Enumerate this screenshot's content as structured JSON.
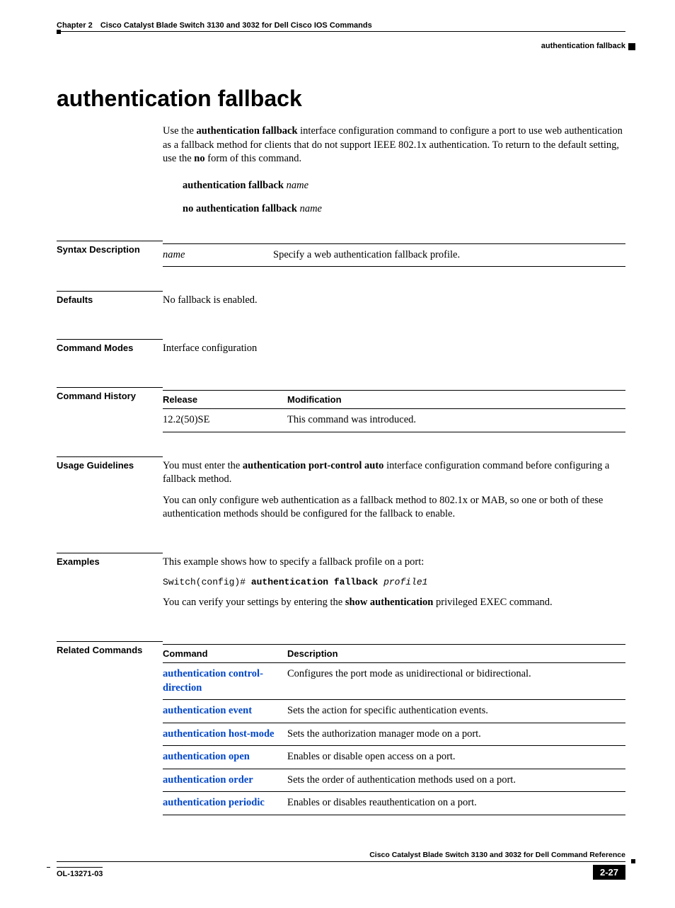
{
  "header": {
    "chapter": "Chapter 2",
    "chapter_title": "Cisco Catalyst Blade Switch 3130 and 3032 for Dell Cisco IOS Commands",
    "running_head": "authentication fallback"
  },
  "title": "authentication fallback",
  "intro": {
    "p1_a": "Use the ",
    "p1_b": "authentication fallback",
    "p1_c": " interface configuration command to configure a port to use web authentication as a fallback method for clients that do not support IEEE 802.1x authentication. To return to the default setting, use the ",
    "p1_d": "no",
    "p1_e": " form of this command.",
    "syntax1_bold": "authentication fallback ",
    "syntax1_ital": "name",
    "syntax2_bold": "no authentication fallback ",
    "syntax2_ital": "name"
  },
  "syntax_description": {
    "label": "Syntax Description",
    "param": "name",
    "desc": "Specify a web authentication fallback profile."
  },
  "defaults": {
    "label": "Defaults",
    "text": "No fallback is enabled."
  },
  "command_modes": {
    "label": "Command Modes",
    "text": "Interface configuration"
  },
  "command_history": {
    "label": "Command History",
    "col1": "Release",
    "col2": "Modification",
    "release": "12.2(50)SE",
    "modification": "This command was introduced."
  },
  "usage": {
    "label": "Usage Guidelines",
    "p1_a": "You must enter the ",
    "p1_b": "authentication port-control auto",
    "p1_c": " interface configuration command before configuring a fallback method.",
    "p2": "You can only configure web authentication as a fallback method to 802.1x or MAB, so one or both of these authentication methods should be configured for the fallback to enable."
  },
  "examples": {
    "label": "Examples",
    "p1": "This example shows how to specify a fallback profile on a port:",
    "code_prefix": "Switch(config)# ",
    "code_bold": "authentication fallback ",
    "code_ital": "profile1",
    "p2_a": "You can verify your settings by entering the ",
    "p2_b": "show authentication",
    "p2_c": " privileged EXEC command."
  },
  "related": {
    "label": "Related Commands",
    "col1": "Command",
    "col2": "Description",
    "rows": [
      {
        "cmd": "authentication control-direction",
        "desc": "Configures the port mode as unidirectional or bidirectional."
      },
      {
        "cmd": "authentication event",
        "desc": "Sets the action for specific authentication events."
      },
      {
        "cmd": "authentication host-mode",
        "desc": "Sets the authorization manager mode on a port."
      },
      {
        "cmd": "authentication open",
        "desc": "Enables or disable open access on a port."
      },
      {
        "cmd": "authentication order",
        "desc": "Sets the order of authentication methods used on a port."
      },
      {
        "cmd": "authentication periodic",
        "desc": "Enables or disables reauthentication on a port."
      }
    ]
  },
  "footer": {
    "book": "Cisco Catalyst Blade Switch 3130 and 3032 for Dell Command Reference",
    "docid": "OL-13271-03",
    "page": "2-27"
  }
}
